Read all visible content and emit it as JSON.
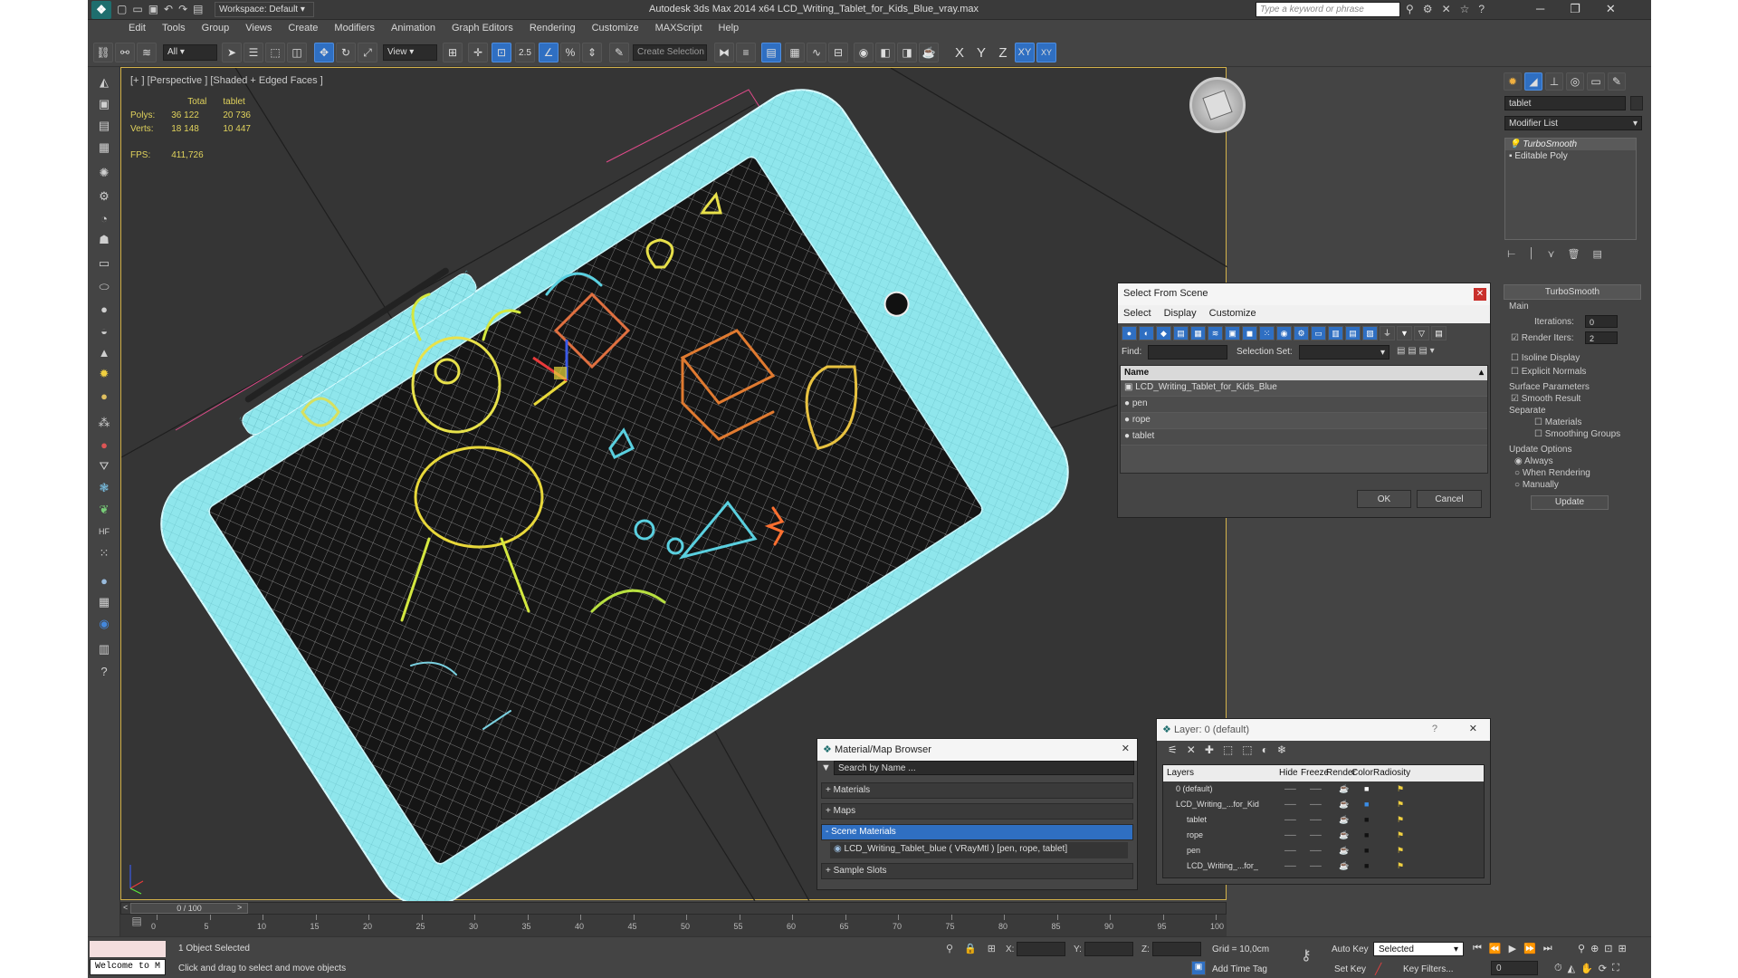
{
  "app": {
    "title": "Autodesk 3ds Max  2014 x64     LCD_Writing_Tablet_for_Kids_Blue_vray.max",
    "workspace": "Workspace: Default",
    "search_placeholder": "Type a keyword or phrase"
  },
  "menu": [
    "Edit",
    "Tools",
    "Group",
    "Views",
    "Create",
    "Modifiers",
    "Animation",
    "Graph Editors",
    "Rendering",
    "Customize",
    "MAXScript",
    "Help"
  ],
  "toolbar": {
    "filter": "All",
    "ref_coord": "View",
    "selection_set": "Create Selection Se",
    "snap": "2.5",
    "axis_x": "X",
    "axis_y": "Y",
    "axis_z": "Z",
    "axis_xy": "XY"
  },
  "viewport": {
    "label": "[+ ] [Perspective ] [Shaded + Edged Faces ]",
    "stats": {
      "col_total": "Total",
      "col_tablet": "tablet",
      "polys_label": "Polys:",
      "polys_total": "36 122",
      "polys_tablet": "20 736",
      "verts_label": "Verts:",
      "verts_total": "18 148",
      "verts_tablet": "10 447",
      "fps_label": "FPS:",
      "fps_value": "411,726"
    }
  },
  "command_panel": {
    "object_name": "tablet",
    "modifier_list": "Modifier List",
    "stack": [
      "TurboSmooth",
      "Editable Poly"
    ],
    "rollout_title": "TurboSmooth",
    "main_label": "Main",
    "iterations_label": "Iterations:",
    "iterations_value": "0",
    "render_iters_label": "Render Iters:",
    "render_iters_value": "2",
    "isoline": "Isoline Display",
    "explicit_normals": "Explicit Normals",
    "surface_params": "Surface Parameters",
    "smooth_result": "Smooth Result",
    "separate": "Separate",
    "materials": "Materials",
    "smoothing_groups": "Smoothing Groups",
    "update_options": "Update Options",
    "always": "Always",
    "when_rendering": "When Rendering",
    "manually": "Manually",
    "update_btn": "Update"
  },
  "select_dialog": {
    "title": "Select From Scene",
    "menu": [
      "Select",
      "Display",
      "Customize"
    ],
    "find_label": "Find:",
    "selset_label": "Selection Set:",
    "col_name": "Name",
    "items": [
      "LCD_Writing_Tablet_for_Kids_Blue",
      "pen",
      "rope",
      "tablet"
    ],
    "ok": "OK",
    "cancel": "Cancel"
  },
  "material_browser": {
    "title": "Material/Map Browser",
    "search": "Search by Name ...",
    "materials": "+ Materials",
    "maps": "+ Maps",
    "scene_materials": "- Scene Materials",
    "scene_item": "LCD_Writing_Tablet_blue  ( VRayMtl ) [pen, rope, tablet]",
    "sample_slots": "+ Sample Slots"
  },
  "layer_dialog": {
    "title": "Layer: 0 (default)",
    "help": "?",
    "cols": [
      "Layers",
      "Hide",
      "Freeze",
      "Render",
      "Color",
      "Radiosity"
    ],
    "rows": [
      "0 (default)",
      "LCD_Writing_...for_Kid",
      "tablet",
      "rope",
      "pen",
      "LCD_Writing_...for_"
    ]
  },
  "trackbar": {
    "frame": "0 / 100",
    "ticks": [
      "0",
      "5",
      "10",
      "15",
      "20",
      "25",
      "30",
      "35",
      "40",
      "45",
      "50",
      "55",
      "60",
      "65",
      "70",
      "75",
      "80",
      "85",
      "90",
      "95",
      "100"
    ]
  },
  "status": {
    "selected": "1 Object Selected",
    "hint": "Click and drag to select and move objects",
    "welcome": "Welcome to M",
    "x_label": "X:",
    "y_label": "Y:",
    "z_label": "Z:",
    "grid": "Grid = 10,0cm",
    "add_time_tag": "Add Time Tag",
    "auto_key": "Auto Key",
    "selected_dd": "Selected",
    "set_key": "Set Key",
    "key_filters": "Key Filters...",
    "frame_field": "0"
  },
  "colors": {
    "accent": "#2f6fc2",
    "tablet_wire": "#8fe6ec",
    "viewport_bg": "#353535"
  }
}
